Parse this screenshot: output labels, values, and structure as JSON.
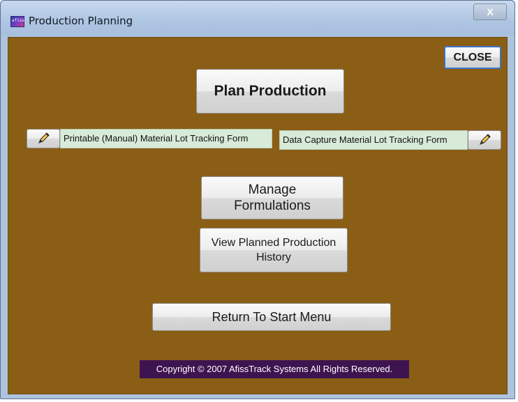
{
  "window": {
    "title": "Production Planning",
    "close_glyph": "X",
    "app_icon_text": "afiss"
  },
  "buttons": {
    "close": "CLOSE",
    "plan_production": "Plan Production",
    "manage_formulations_line1": "Manage",
    "manage_formulations_line2": "Formulations",
    "view_history_line1": "View Planned Production",
    "view_history_line2": "History",
    "return_start": "Return To Start Menu"
  },
  "links": {
    "printable_form": "Printable (Manual) Material Lot Tracking Form",
    "data_capture_form": "Data Capture Material Lot Tracking Form"
  },
  "footer": {
    "copyright": "Copyright © 2007 AfissTrack Systems All Rights Reserved."
  },
  "icons": [
    "pencil-icon",
    "app-icon",
    "window-close-icon"
  ],
  "colors": {
    "client_background": "#8b5e15",
    "copyright_background": "#3e1450",
    "label_background": "#d8ead8"
  }
}
